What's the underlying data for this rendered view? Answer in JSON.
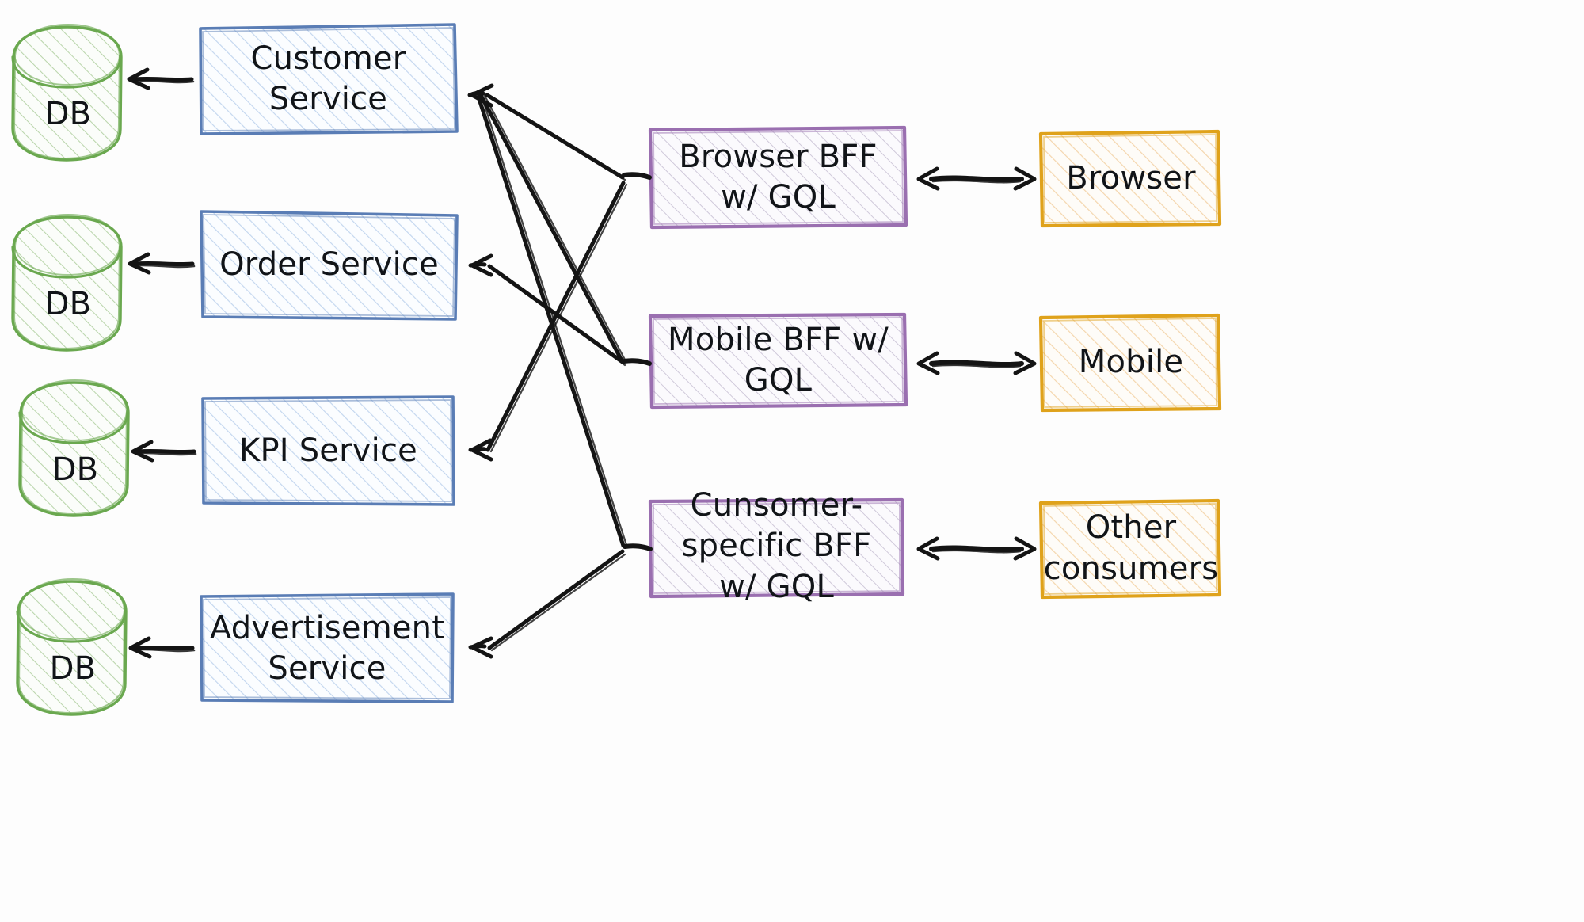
{
  "diagram": {
    "title": "BFF (Backend For Frontend) architecture diagram",
    "style": "hand-drawn sketch",
    "background_color": "#fdfdfd"
  },
  "palette": {
    "database_stroke": "#6aa84f",
    "database_fill": "#cfe3c4",
    "service_stroke": "#5a7db5",
    "service_fill": "#b8cdea",
    "bff_stroke": "#9a6fb0",
    "bff_fill": "#cac3d6",
    "consumer_stroke": "#dfa21b",
    "consumer_fill": "#f3d2a3",
    "arrow_stroke": "#141414",
    "text_color": "#111418"
  },
  "databases": [
    {
      "id": "db-customer",
      "label": "DB"
    },
    {
      "id": "db-order",
      "label": "DB"
    },
    {
      "id": "db-kpi",
      "label": "DB"
    },
    {
      "id": "db-advertisement",
      "label": "DB"
    }
  ],
  "services": [
    {
      "id": "customer-service",
      "label": "Customer\nService"
    },
    {
      "id": "order-service",
      "label": "Order Service"
    },
    {
      "id": "kpi-service",
      "label": "KPI Service"
    },
    {
      "id": "advertisement-service",
      "label": "Advertisement\nService"
    }
  ],
  "bffs": [
    {
      "id": "browser-bff",
      "label": "Browser BFF\nw/ GQL"
    },
    {
      "id": "mobile-bff",
      "label": "Mobile BFF w/\nGQL"
    },
    {
      "id": "consumer-bff",
      "label": "Cunsomer-\nspecific BFF\nw/ GQL"
    }
  ],
  "consumers": [
    {
      "id": "browser",
      "label": "Browser"
    },
    {
      "id": "mobile",
      "label": "Mobile"
    },
    {
      "id": "other-consumers",
      "label": "Other\nconsumers"
    }
  ],
  "edges": [
    {
      "from": "customer-service",
      "to": "db-customer",
      "kind": "arrow-single",
      "direction": "left"
    },
    {
      "from": "order-service",
      "to": "db-order",
      "kind": "arrow-single",
      "direction": "left"
    },
    {
      "from": "kpi-service",
      "to": "db-kpi",
      "kind": "arrow-single",
      "direction": "left"
    },
    {
      "from": "advertisement-service",
      "to": "db-advertisement",
      "kind": "arrow-single",
      "direction": "left"
    },
    {
      "from": "browser-bff",
      "to": "customer-service",
      "kind": "arrow-single",
      "direction": "left"
    },
    {
      "from": "browser-bff",
      "to": "kpi-service",
      "kind": "arrow-single",
      "direction": "left"
    },
    {
      "from": "mobile-bff",
      "to": "customer-service",
      "kind": "arrow-single",
      "direction": "left"
    },
    {
      "from": "mobile-bff",
      "to": "order-service",
      "kind": "arrow-single",
      "direction": "left"
    },
    {
      "from": "consumer-bff",
      "to": "customer-service",
      "kind": "arrow-single",
      "direction": "left"
    },
    {
      "from": "consumer-bff",
      "to": "advertisement-service",
      "kind": "arrow-single",
      "direction": "left"
    },
    {
      "from": "browser-bff",
      "to": "browser",
      "kind": "arrow-double",
      "direction": "both"
    },
    {
      "from": "mobile-bff",
      "to": "mobile",
      "kind": "arrow-double",
      "direction": "both"
    },
    {
      "from": "consumer-bff",
      "to": "other-consumers",
      "kind": "arrow-double",
      "direction": "both"
    }
  ]
}
